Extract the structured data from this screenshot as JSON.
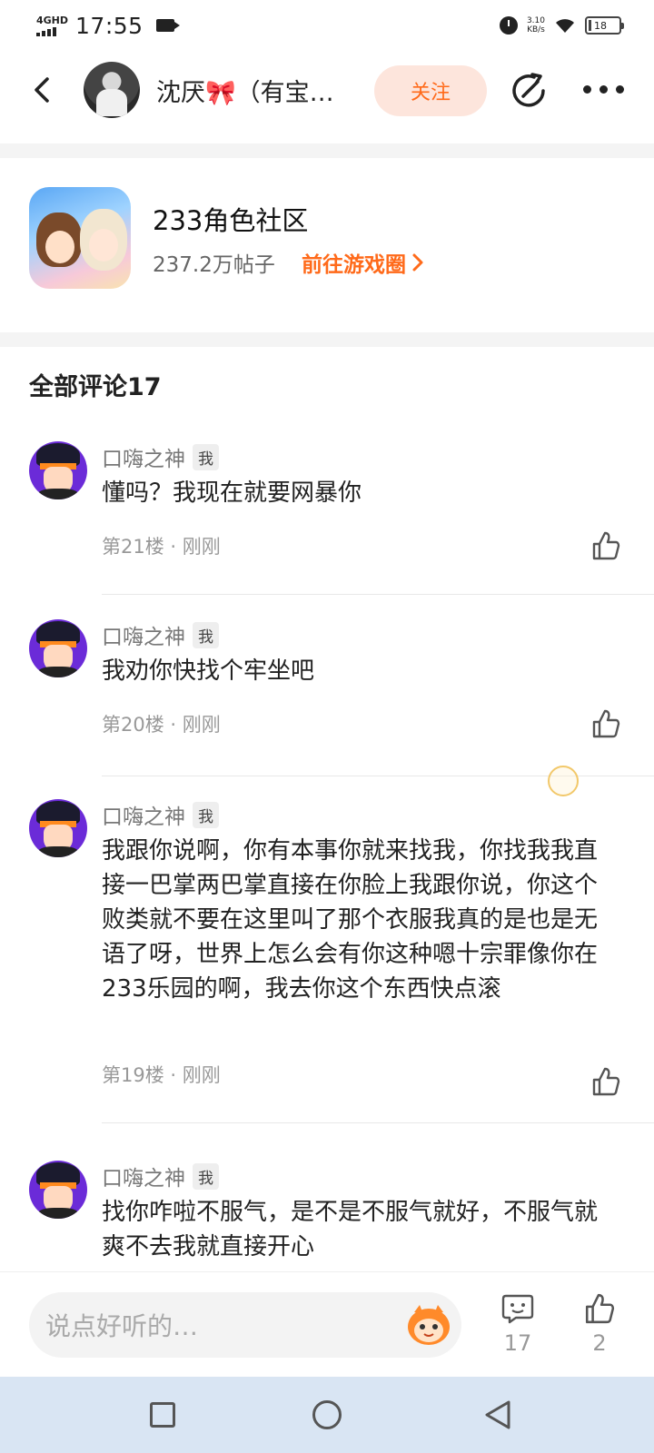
{
  "status_bar": {
    "network": "4GHD",
    "time": "17:55",
    "speed_value": "3.10",
    "speed_unit": "KB/s",
    "battery": "18"
  },
  "header": {
    "author_name": "沈厌🎀（有宝…",
    "follow_label": "关注"
  },
  "game": {
    "title": "233角色社区",
    "posts": "237.2万帖子",
    "link_label": "前往游戏圈"
  },
  "comments_section": {
    "title": "全部评论17"
  },
  "comments": [
    {
      "author": "口嗨之神",
      "tag": "我",
      "text": "懂吗？我现在就要网暴你",
      "floor": "第21楼",
      "time": "刚刚"
    },
    {
      "author": "口嗨之神",
      "tag": "我",
      "text": "我劝你快找个牢坐吧",
      "floor": "第20楼",
      "time": "刚刚"
    },
    {
      "author": "口嗨之神",
      "tag": "我",
      "text": "我跟你说啊，你有本事你就来找我，你找我我直接一巴掌两巴掌直接在你脸上我跟你说，你这个败类就不要在这里叫了那个衣服我真的是也是无语了呀，世界上怎么会有你这种嗯十宗罪像你在233乐园的啊，我去你这个东西快点滚",
      "floor": "第19楼",
      "time": "刚刚"
    },
    {
      "author": "口嗨之神",
      "tag": "我",
      "text": "找你咋啦不服气，是不是不服气就好，不服气就爽不去我就直接开心",
      "floor": "",
      "time": ""
    }
  ],
  "bottom_bar": {
    "input_placeholder": "说点好听的…",
    "comment_count": "17",
    "like_count": "2"
  },
  "icons": {
    "back": "back-arrow-icon",
    "share": "share-icon",
    "more": "more-dots-icon",
    "like": "thumbs-up-icon",
    "comment": "comment-bubble-icon"
  },
  "colors": {
    "accent": "#ff6a1a",
    "follow_bg": "#fde5dc"
  }
}
